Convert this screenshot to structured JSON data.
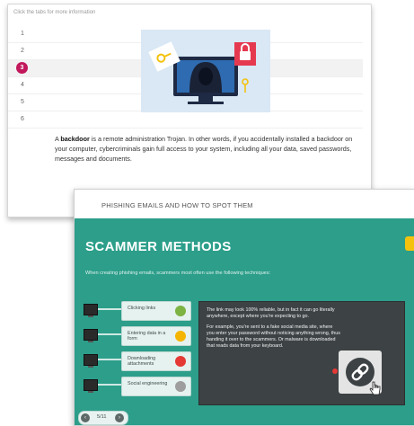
{
  "top_card": {
    "hint": "Click the tabs for more information",
    "tabs": [
      "1",
      "2",
      "3",
      "4",
      "5",
      "6"
    ],
    "active_tab": "3",
    "description_term": "backdoor",
    "description_prefix": "A ",
    "description_rest": " is a remote administration Trojan. In other words, if you accidentally installed a backdoor on your computer, cybercriminals gain full access to your system, including all your data, saved passwords, messages and documents."
  },
  "bottom_card": {
    "header_title": "PHISHING EMAILS AND HOW TO SPOT THEM",
    "title": "SCAMMER METHODS",
    "subtitle": "When creating phishing emails, scammers most often use the following techniques:",
    "methods": [
      {
        "label": "Clicking links",
        "color": "#7cb342"
      },
      {
        "label": "Entering data in a form",
        "color": "#f4b400"
      },
      {
        "label": "Downloading attachments",
        "color": "#e53935"
      },
      {
        "label": "Social engineering",
        "color": "#9e9e9e"
      }
    ],
    "panel_p1": "The link may look 100% reliable, but in fact it can go literally anywhere, except where you're expecting to go.",
    "panel_p2": "For example, you're sent to a fake social media site, where you enter your password without noticing anything wrong, thus handing it over to the scammers. Or malware is downloaded that reads data from your keyboard.",
    "nav_count": "5/11"
  },
  "colors": {
    "accent_active_tab": "#c2185b",
    "teal": "#2c9e8a",
    "panel_dark": "#3d4245"
  }
}
